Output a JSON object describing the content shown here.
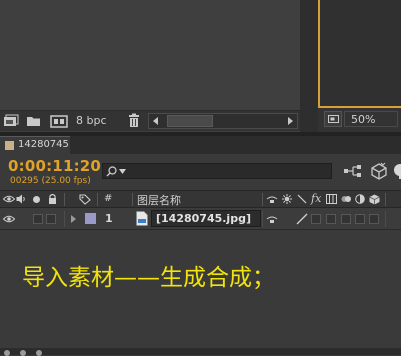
{
  "project_panel": {
    "bit_depth": "8 bpc"
  },
  "viewer": {
    "zoom": "50%"
  },
  "timeline": {
    "comp_tab_label": "14280745",
    "timecode": "0:00:11:20",
    "frame_info": "00295 (25.00 fps)",
    "search_value": "",
    "header": {
      "number_col": "#",
      "layer_name_col": "图层名称"
    },
    "layers": [
      {
        "number": "1",
        "name": "[14280745.jpg]"
      }
    ],
    "annotation": "导入素材——生成合成；"
  },
  "colors": {
    "timecode": "#e0a227",
    "annotation": "#f2e30a",
    "label_swatch": "#9a9ac8",
    "viewer_border": "#d4a23c"
  }
}
